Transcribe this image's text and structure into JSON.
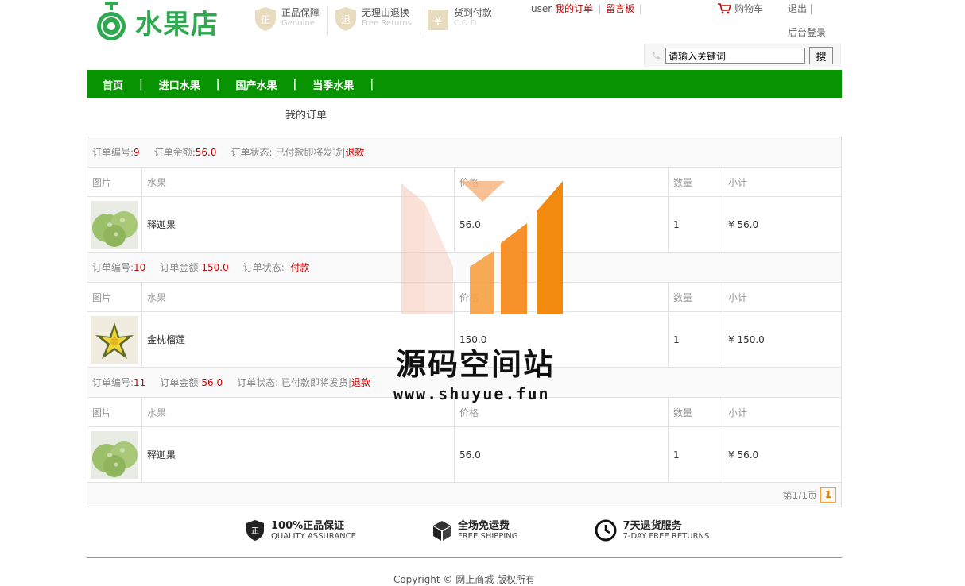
{
  "header": {
    "logo_text": "水果店",
    "badges": [
      {
        "cn": "正品保障",
        "en": "Genuine"
      },
      {
        "cn": "无理由退换",
        "en": "Free Returns"
      },
      {
        "cn": "货到付款",
        "en": "C.O.D"
      }
    ],
    "user": "user",
    "my_orders": "我的订单",
    "message_board": "留言板",
    "cart": "购物车",
    "logout": "退出",
    "admin": "后台登录",
    "search_value": "请输入关键词",
    "search_button": "搜"
  },
  "nav": [
    "首页",
    "进口水果",
    "国产水果",
    "当季水果"
  ],
  "page_title": "我的订单",
  "labels": {
    "order_no": "订单编号:",
    "order_amount": "订单金额:",
    "order_status": "订单状态:",
    "refund": "退款",
    "pay": "付款",
    "col_img": "图片",
    "col_fruit": "水果",
    "col_price": "价格",
    "col_qty": "数量",
    "col_subtotal": "小计"
  },
  "orders": [
    {
      "no": "9",
      "amount": "56.0",
      "status": "已付款即将发货|",
      "action": "退款",
      "fruit": "释迦果",
      "price": "56.0",
      "qty": "1",
      "subtotal": "¥ 56.0",
      "img": "custard-apple"
    },
    {
      "no": "10",
      "amount": "150.0",
      "status": "",
      "action": "付款",
      "fruit": "金枕榴莲",
      "price": "150.0",
      "qty": "1",
      "subtotal": "¥ 150.0",
      "img": "durian"
    },
    {
      "no": "11",
      "amount": "56.0",
      "status": "已付款即将发货|",
      "action": "退款",
      "fruit": "释迦果",
      "price": "56.0",
      "qty": "1",
      "subtotal": "¥ 56.0",
      "img": "custard-apple"
    }
  ],
  "pager": {
    "text": "第1/1页",
    "current": "1"
  },
  "services": [
    {
      "cn": "100%正品保证",
      "en": "QUALITY ASSURANCE"
    },
    {
      "cn": "全场免运费",
      "en": "FREE SHIPPING"
    },
    {
      "cn": "7天退货服务",
      "en": "7-DAY FREE RETURNS"
    }
  ],
  "copyright": "Copyright © 网上商城 版权所有",
  "watermark": {
    "cn": "源码空间站",
    "url": "www.shuyue.fun"
  },
  "colors": {
    "nav_green": "#079400",
    "accent_red": "#cc0000",
    "logo_green": "#2fa84f"
  }
}
